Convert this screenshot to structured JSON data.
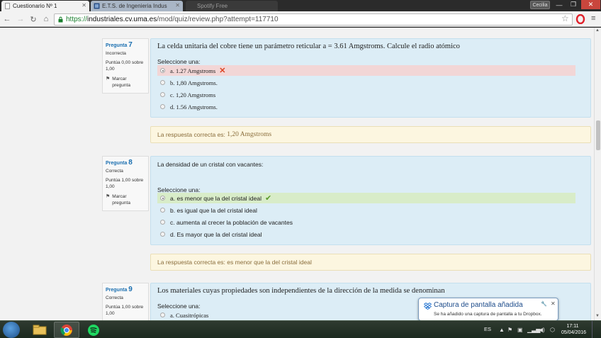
{
  "browser": {
    "tabs": [
      {
        "label": "Cuestionario Nº 1",
        "active": true
      },
      {
        "label": "E.T.S. de Ingenieria Indus",
        "active": false
      },
      {
        "label": "Spotify Free",
        "active": false
      }
    ],
    "profile_name": "Cecilia",
    "url_scheme": "https://",
    "url_host": "industriales.cv.uma.es",
    "url_path": "/mod/quiz/review.php?attempt=117710"
  },
  "quiz": {
    "questions": [
      {
        "label": "Pregunta",
        "number": "7",
        "state": "Incorrecta",
        "grade": "Puntúa 0,00 sobre 1,00",
        "flag": "Marcar pregunta",
        "text": "La celda unitaria del cobre tiene un parámetro reticular a = 3.61 Amgstroms. Calcule el radio atómico",
        "prompt": "Seleccione una:",
        "answers": [
          {
            "letter": "a.",
            "text": "1.27 Amgstroms",
            "selected": true,
            "result": "incorrect"
          },
          {
            "letter": "b.",
            "text": "1,80 Amgstroms.",
            "selected": false
          },
          {
            "letter": "c.",
            "text": "1,20 Amgstroms",
            "selected": false
          },
          {
            "letter": "d.",
            "text": "1.56 Amgstroms.",
            "selected": false
          }
        ],
        "feedback_prefix": "La respuesta correcta es:",
        "feedback_answer": "1,20 Amgstroms"
      },
      {
        "label": "Pregunta",
        "number": "8",
        "state": "Correcta",
        "grade": "Puntúa 1,00 sobre 1,00",
        "flag": "Marcar pregunta",
        "text": "La densidad de un cristal con vacantes:",
        "prompt": "Seleccione una:",
        "answers": [
          {
            "letter": "a.",
            "text": "es menor que la del cristal ideal",
            "selected": true,
            "result": "correct"
          },
          {
            "letter": "b.",
            "text": "es igual que la del cristal ideal",
            "selected": false
          },
          {
            "letter": "c.",
            "text": "aumenta al crecer la población de vacantes",
            "selected": false
          },
          {
            "letter": "d.",
            "text": "Es mayor que la del cristal ideal",
            "selected": false
          }
        ],
        "feedback_prefix": "La respuesta correcta es:",
        "feedback_answer": "es menor que la del cristal ideal"
      },
      {
        "label": "Pregunta",
        "number": "9",
        "state": "Correcta",
        "grade": "Puntúa 1,00 sobre 1,00",
        "text": "Los materiales cuyas propiedades son independientes de la dirección de la medida se denominan",
        "prompt": "Seleccione una:",
        "answers": [
          {
            "letter": "a.",
            "text": "Cuasitrópicas",
            "selected": false
          }
        ]
      }
    ]
  },
  "notification": {
    "title": "Captura de pantalla añadida",
    "body": "Se ha añadido una captura de pantalla a tu Dropbox."
  },
  "taskbar": {
    "language": "ES",
    "time": "17:11",
    "date": "05/04/2016"
  },
  "colors": {
    "correct_bg": "#d8ecc8",
    "incorrect_bg": "#f2d6d6",
    "question_bg": "#dcedf6",
    "feedback_bg": "#fcf6e0",
    "link_blue": "#1a6fb0"
  }
}
